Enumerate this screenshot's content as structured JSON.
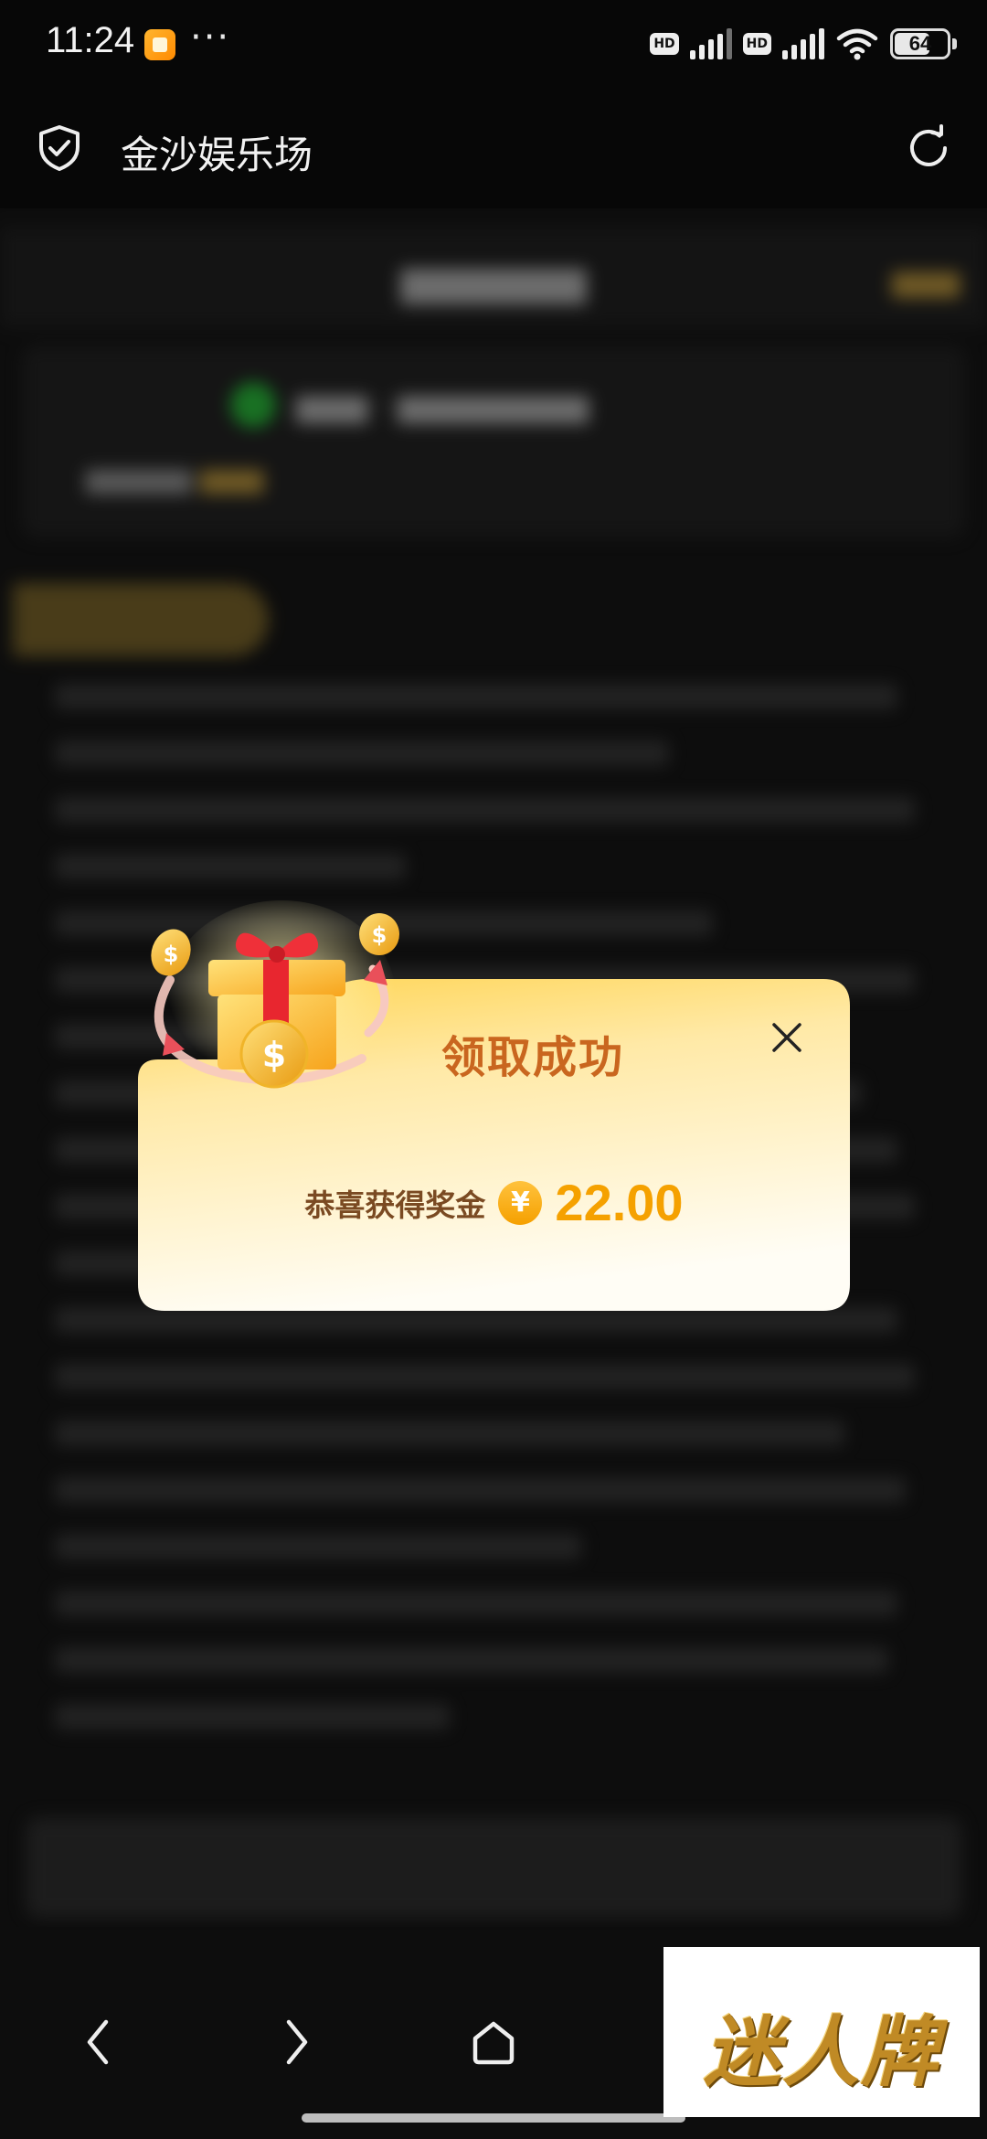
{
  "status_bar": {
    "time": "11:24",
    "more": "···",
    "hd1": "HD",
    "hd2": "HD",
    "battery": "64"
  },
  "toolbar": {
    "site_title": "金沙娱乐场",
    "shield_icon": "shield-check-icon",
    "refresh_icon": "refresh-icon"
  },
  "dialog": {
    "title": "领取成功",
    "reward_label": "恭喜获得奖金",
    "currency_symbol": "¥",
    "amount": "22.00",
    "close_icon": "close-icon",
    "gift_icon": "gift-box-icon"
  },
  "navbar": {
    "back_icon": "chevron-left-icon",
    "forward_icon": "chevron-right-icon",
    "home_icon": "home-icon"
  },
  "watermark": {
    "text": "迷人牌"
  },
  "colors": {
    "accent_gold": "#f5a100",
    "title_orange": "#c9661f",
    "dialog_top": "#ffd658",
    "dialog_bottom": "#fffaf0"
  }
}
